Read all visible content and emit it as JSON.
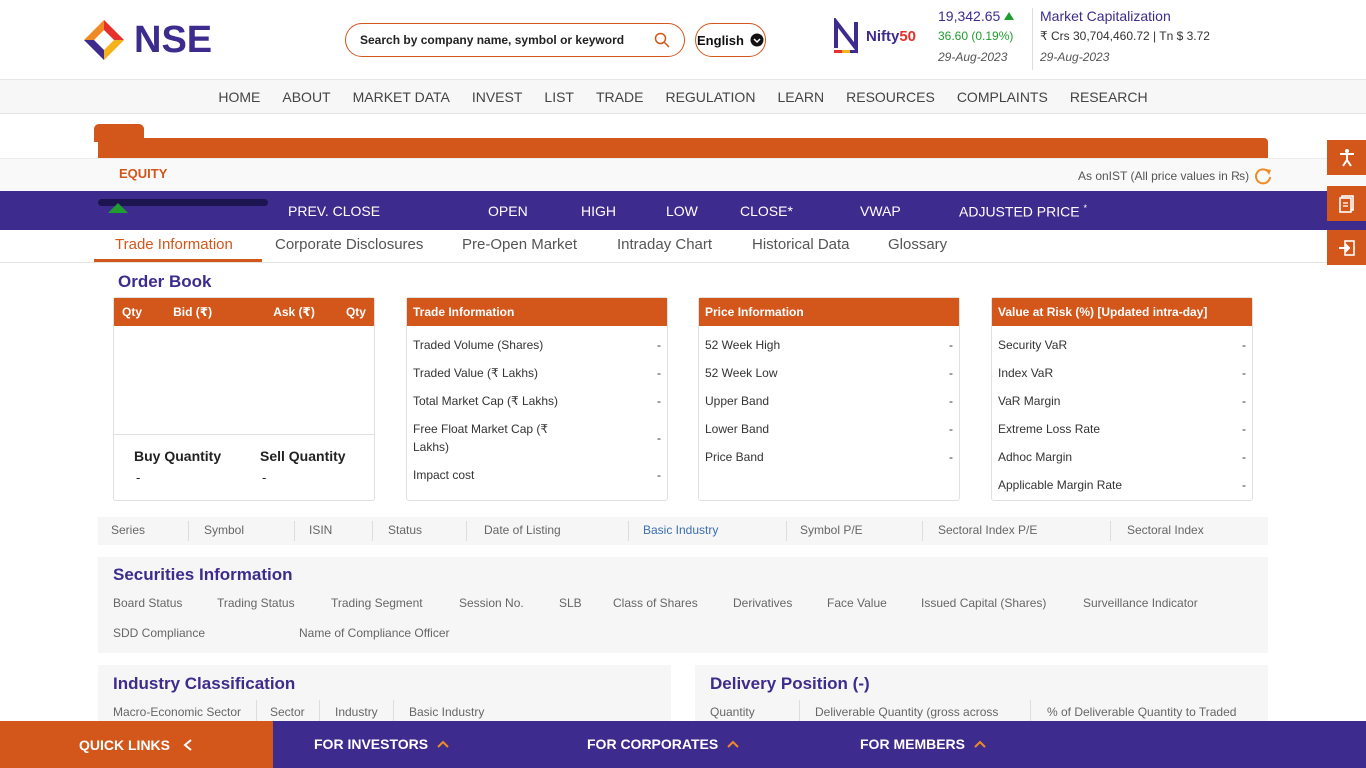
{
  "header": {
    "logo_text": "NSE",
    "search_placeholder": "Search by company name, symbol or keyword",
    "language": "English",
    "nifty_logo": {
      "prefix": "Nifty",
      "suffix": "50"
    },
    "nifty": {
      "value": "19,342.65",
      "change": "36.60 (0.19%)",
      "date": "29-Aug-2023",
      "direction": "up"
    },
    "market_cap": {
      "title": "Market Capitalization",
      "value": "₹ Crs 30,704,460.72 | Tn $ 3.72",
      "date": "29-Aug-2023"
    }
  },
  "nav": [
    "HOME",
    "ABOUT",
    "MARKET DATA",
    "INVEST",
    "LIST",
    "TRADE",
    "REGULATION",
    "LEARN",
    "RESOURCES",
    "COMPLAINTS",
    "RESEARCH"
  ],
  "equity_label": "EQUITY",
  "as_on": "As onIST (All price values in ₨)",
  "price_headers": {
    "prev_close": "PREV. CLOSE",
    "open": "OPEN",
    "high": "HIGH",
    "low": "LOW",
    "close": "CLOSE*",
    "vwap": "VWAP",
    "adjusted": "ADJUSTED PRICE",
    "adjusted_sup": "*"
  },
  "tabs": [
    "Trade Information",
    "Corporate Disclosures",
    "Pre-Open Market",
    "Intraday Chart",
    "Historical Data",
    "Glossary"
  ],
  "order_book": {
    "title": "Order Book",
    "columns": [
      "Qty",
      "Bid (₹)",
      "Ask (₹)",
      "Qty"
    ],
    "buy_label": "Buy Quantity",
    "sell_label": "Sell Quantity",
    "buy_value": "-",
    "sell_value": "-"
  },
  "trade_info": {
    "title": "Trade Information",
    "rows": [
      {
        "label": "Traded Volume (Shares)",
        "value": "-"
      },
      {
        "label": "Traded Value (₹ Lakhs)",
        "value": "-"
      },
      {
        "label": "Total Market Cap (₹ Lakhs)",
        "value": "-"
      },
      {
        "label": "Free Float Market Cap (₹ Lakhs)",
        "value": "-"
      },
      {
        "label": "Impact cost",
        "value": "-"
      }
    ]
  },
  "price_info": {
    "title": "Price Information",
    "rows": [
      {
        "label": "52 Week High",
        "value": "-"
      },
      {
        "label": "52 Week Low",
        "value": "-"
      },
      {
        "label": "Upper Band",
        "value": "-"
      },
      {
        "label": "Lower Band",
        "value": "-"
      },
      {
        "label": "Price Band",
        "value": "-"
      }
    ]
  },
  "var_info": {
    "title": "Value at Risk (%) [Updated intra-day]",
    "rows": [
      {
        "label": "Security VaR",
        "value": "-"
      },
      {
        "label": "Index VaR",
        "value": "-"
      },
      {
        "label": "VaR Margin",
        "value": "-"
      },
      {
        "label": "Extreme Loss Rate",
        "value": "-"
      },
      {
        "label": "Adhoc Margin",
        "value": "-"
      },
      {
        "label": "Applicable Margin Rate",
        "value": "-"
      }
    ]
  },
  "info_strip": [
    "Series",
    "Symbol",
    "ISIN",
    "Status",
    "Date of Listing",
    "Basic Industry",
    "Symbol P/E",
    "Sectoral Index P/E",
    "Sectoral Index"
  ],
  "securities": {
    "title": "Securities Information",
    "row1": [
      "Board Status",
      "Trading Status",
      "Trading Segment",
      "Session No.",
      "SLB",
      "Class of Shares",
      "Derivatives",
      "Face Value",
      "Issued Capital (Shares)",
      "Surveillance Indicator"
    ],
    "row2": [
      "SDD Compliance",
      "Name of Compliance Officer"
    ]
  },
  "industry": {
    "title": "Industry Classification",
    "cols": [
      "Macro-Economic Sector",
      "Sector",
      "Industry",
      "Basic Industry"
    ]
  },
  "delivery": {
    "title": "Delivery Position (-)",
    "cols": [
      "Quantity",
      "Deliverable Quantity (gross across",
      "% of Deliverable Quantity to Traded"
    ]
  },
  "bottom_bar": {
    "quick_links": "QUICK LINKS",
    "investors": "FOR INVESTORS",
    "corporates": "FOR CORPORATES",
    "members": "FOR MEMBERS"
  },
  "colors": {
    "primary": "#3d2c8d",
    "accent": "#d3561a",
    "positive": "#1f9d2f"
  }
}
